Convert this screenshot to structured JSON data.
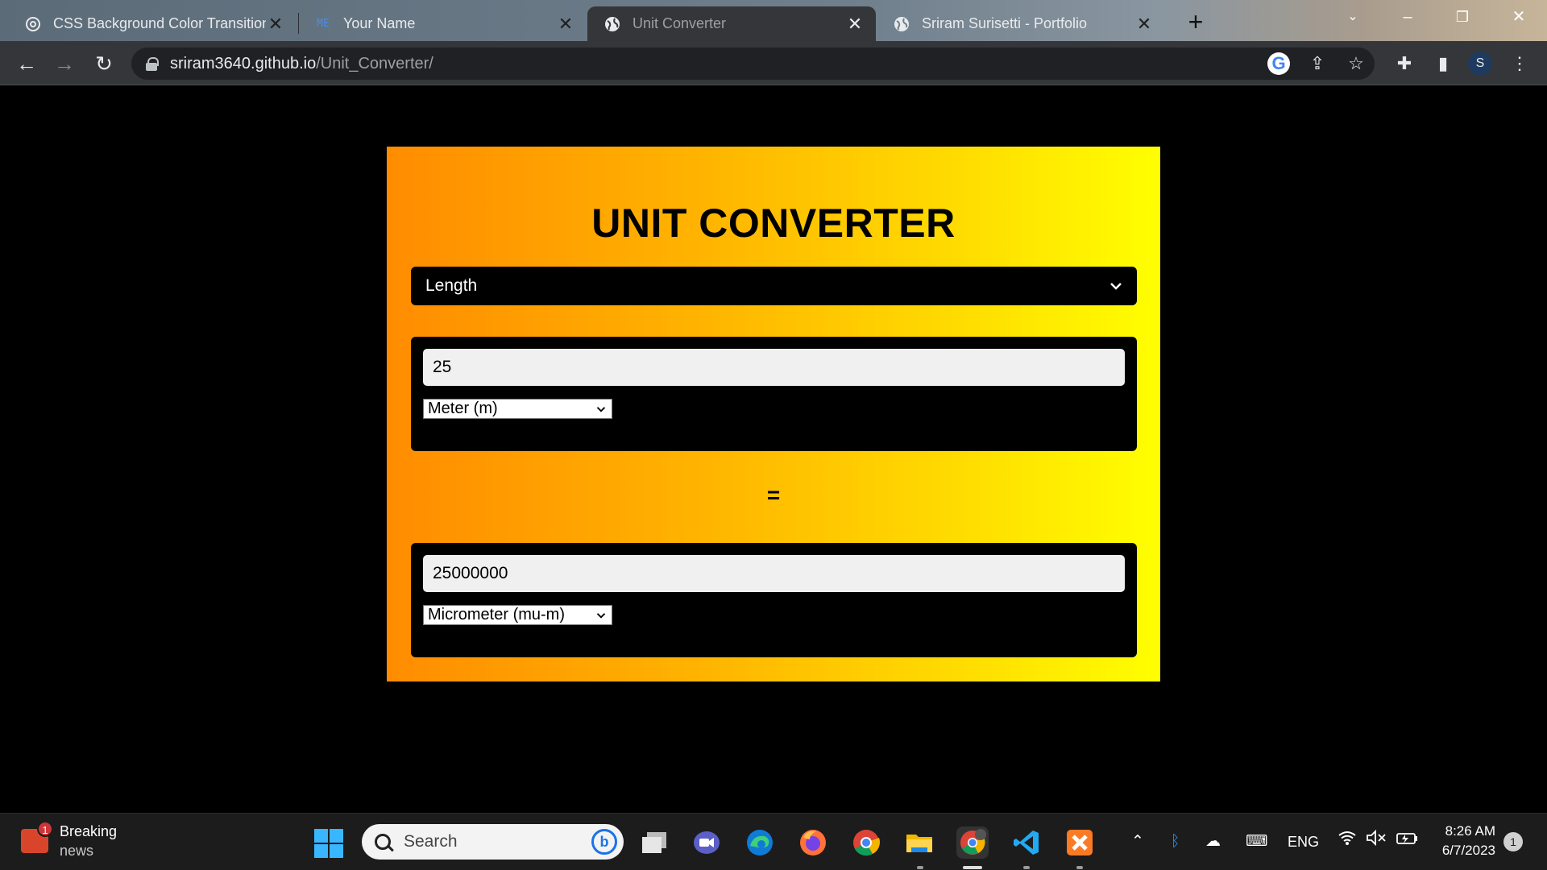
{
  "browser": {
    "tabs": [
      {
        "title": "CSS Background Color Transition",
        "icon": "chatgpt-icon",
        "active": false
      },
      {
        "title": "Your Name",
        "icon": "me-icon",
        "active": false
      },
      {
        "title": "Unit Converter",
        "icon": "globe-icon",
        "active": true
      },
      {
        "title": "Sriram Surisetti - Portfolio",
        "icon": "globe-icon",
        "active": false
      }
    ],
    "url_host": "sriram3640.github.io",
    "url_path": "/Unit_Converter/",
    "profile_initial": "S"
  },
  "converter": {
    "title": "UNIT CONVERTER",
    "measurement_type": "Length",
    "from_value": "25",
    "from_unit": "Meter (m)",
    "equals": "=",
    "to_value": "25000000",
    "to_unit": "Micrometer (mu-m)",
    "colors": {
      "gradient_start": "#ff8c00",
      "gradient_end": "#ffff00"
    }
  },
  "taskbar": {
    "news_title": "Breaking",
    "news_sub": "news",
    "news_badge": "1",
    "search_placeholder": "Search",
    "language": "ENG",
    "time": "8:26 AM",
    "date": "6/7/2023",
    "notifications": "1"
  }
}
